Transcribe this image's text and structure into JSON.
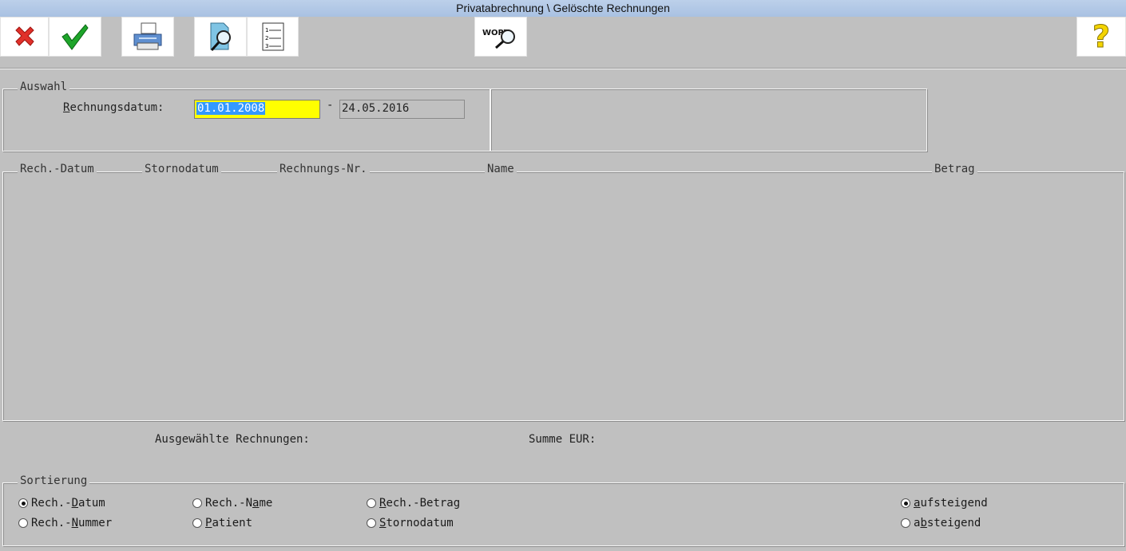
{
  "window": {
    "title": "Privatabrechnung \\ Gelöschte Rechnungen"
  },
  "toolbar": {
    "buttons": [
      {
        "name": "cancel",
        "icon": "red-x-icon"
      },
      {
        "name": "confirm",
        "icon": "green-check-icon"
      },
      {
        "name": "print",
        "icon": "printer-icon"
      },
      {
        "name": "preview",
        "icon": "document-magnifier-icon"
      },
      {
        "name": "list",
        "icon": "numbered-list-icon"
      },
      {
        "name": "word-search",
        "icon": "word-search-icon",
        "text": "WORT"
      },
      {
        "name": "help",
        "icon": "question-mark-icon",
        "text": "?"
      }
    ]
  },
  "auswahl": {
    "legend": "Auswahl",
    "date_label_hotkey": "R",
    "date_label_rest": "echnungsdatum:",
    "date_from": "01.01.2008",
    "separator": "-",
    "date_to": "24.05.2016"
  },
  "list": {
    "columns": [
      "Rech.-Datum",
      "Stornodatum",
      "Rechnungs-Nr.",
      "Name",
      "Betrag"
    ],
    "rows": []
  },
  "summary": {
    "selected_label": "Ausgewählte Rechnungen:",
    "sum_label": "Summe EUR:"
  },
  "sortierung": {
    "legend": "Sortierung",
    "options": [
      {
        "pre": "Rech.-",
        "key": "D",
        "post": "atum",
        "checked": true
      },
      {
        "pre": "Rech.-",
        "key": "N",
        "post": "ummer",
        "checked": false
      },
      {
        "pre": "Rech.-N",
        "key": "a",
        "post": "me",
        "checked": false
      },
      {
        "pre": "",
        "key": "P",
        "post": "atient",
        "checked": false
      },
      {
        "pre": "",
        "key": "R",
        "post": "ech.-Betrag",
        "checked": false
      },
      {
        "pre": "",
        "key": "S",
        "post": "tornodatum",
        "checked": false
      }
    ],
    "order": [
      {
        "pre": "",
        "key": "a",
        "post": "ufsteigend",
        "checked": true
      },
      {
        "pre": "a",
        "key": "b",
        "post": "steigend",
        "checked": false
      }
    ]
  },
  "colors": {
    "highlight": "#ffff00",
    "selection": "#3399ff",
    "background": "#c0c0c0"
  }
}
